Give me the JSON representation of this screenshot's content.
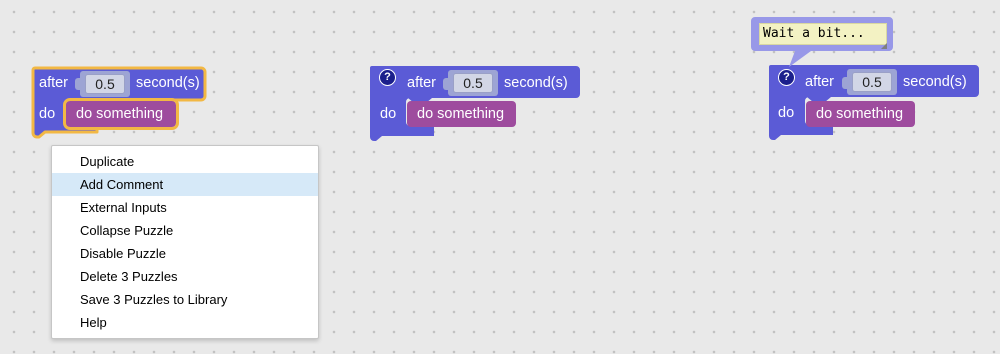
{
  "blocks": [
    {
      "after_label": "after",
      "value": "0.5",
      "unit_label": "second(s)",
      "do_label": "do",
      "statement_label": "do something",
      "selected": true,
      "has_help_icon": false
    },
    {
      "after_label": "after",
      "value": "0.5",
      "unit_label": "second(s)",
      "do_label": "do",
      "statement_label": "do something",
      "selected": false,
      "has_help_icon": true,
      "help_icon_glyph": "?"
    },
    {
      "after_label": "after",
      "value": "0.5",
      "unit_label": "second(s)",
      "do_label": "do",
      "statement_label": "do something",
      "selected": false,
      "has_help_icon": true,
      "help_icon_glyph": "?",
      "comment": "Wait a bit..."
    }
  ],
  "context_menu": {
    "items": [
      {
        "label": "Duplicate",
        "highlighted": false
      },
      {
        "label": "Add Comment",
        "highlighted": true
      },
      {
        "label": "External Inputs",
        "highlighted": false
      },
      {
        "label": "Collapse Puzzle",
        "highlighted": false
      },
      {
        "label": "Disable Puzzle",
        "highlighted": false
      },
      {
        "label": "Delete 3 Puzzles",
        "highlighted": false
      },
      {
        "label": "Save 3 Puzzles to Library",
        "highlighted": false
      },
      {
        "label": "Help",
        "highlighted": false
      }
    ]
  },
  "colors": {
    "block": "#5b5bd6",
    "block_dark": "#4646b0",
    "selection": "#f2b844",
    "statement": "#9e4c9e",
    "menu_highlight": "#d6e9f8",
    "comment_background": "#f3f2c3",
    "workspace": "#e9e9e9"
  }
}
